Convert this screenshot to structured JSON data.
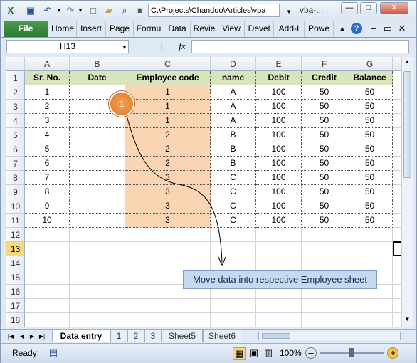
{
  "window": {
    "path": "C:\\Projects\\Chandoo\\Articles\\vba",
    "title": "vba-...",
    "min_label": "—",
    "max_label": "□",
    "close_label": "✕"
  },
  "ribbon": {
    "file_label": "File",
    "tabs": [
      "Home",
      "Insert",
      "Page",
      "Formu",
      "Data",
      "Revie",
      "View",
      "Devel",
      "Add-I",
      "Powe"
    ]
  },
  "formula_bar": {
    "name_box": "H13",
    "fx_label": "fx",
    "value": ""
  },
  "columns": [
    "A",
    "B",
    "C",
    "D",
    "E",
    "F",
    "G"
  ],
  "rows": [
    "1",
    "2",
    "3",
    "4",
    "5",
    "6",
    "7",
    "8",
    "9",
    "10",
    "11",
    "12",
    "13",
    "14",
    "15",
    "16",
    "17",
    "18"
  ],
  "active_row": "13",
  "table": {
    "headers": [
      "Sr. No.",
      "Date",
      "Employee code",
      "name",
      "Debit",
      "Credit",
      "Balance"
    ],
    "data": [
      [
        "1",
        "",
        "1",
        "A",
        "100",
        "50",
        "50"
      ],
      [
        "2",
        "",
        "1",
        "A",
        "100",
        "50",
        "50"
      ],
      [
        "3",
        "",
        "1",
        "A",
        "100",
        "50",
        "50"
      ],
      [
        "4",
        "",
        "2",
        "B",
        "100",
        "50",
        "50"
      ],
      [
        "5",
        "",
        "2",
        "B",
        "100",
        "50",
        "50"
      ],
      [
        "6",
        "",
        "2",
        "B",
        "100",
        "50",
        "50"
      ],
      [
        "7",
        "",
        "3",
        "C",
        "100",
        "50",
        "50"
      ],
      [
        "8",
        "",
        "3",
        "C",
        "100",
        "50",
        "50"
      ],
      [
        "9",
        "",
        "3",
        "C",
        "100",
        "50",
        "50"
      ],
      [
        "10",
        "",
        "3",
        "C",
        "100",
        "50",
        "50"
      ]
    ]
  },
  "annotation": {
    "marker": "1",
    "callout": "Move data into respective Employee sheet"
  },
  "sheets": [
    "Data entry",
    "1",
    "2",
    "3",
    "Sheet5",
    "Sheet6"
  ],
  "status": {
    "ready": "Ready",
    "zoom": "100%"
  },
  "colors": {
    "header_fill": "#d7e4bc",
    "employee_fill": "#fbd4b4",
    "file_tab": "#2c7a32",
    "callout_fill": "#c5d9f1"
  }
}
